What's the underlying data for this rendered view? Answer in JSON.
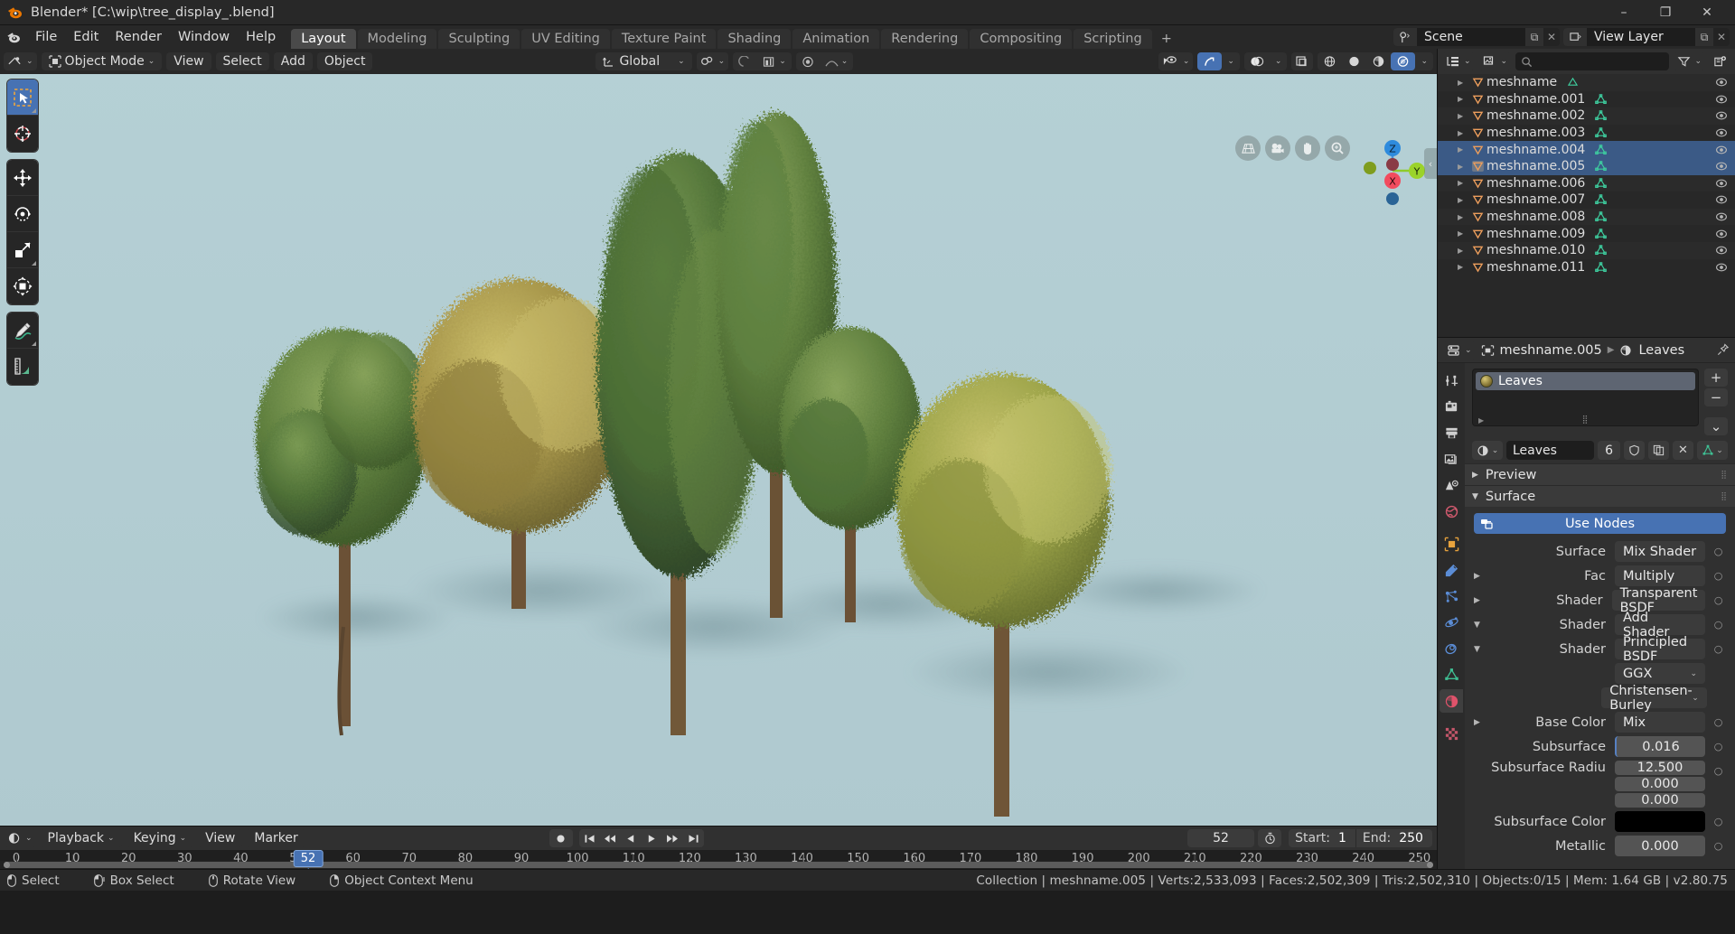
{
  "window": {
    "title": "Blender* [C:\\wip\\tree_display_.blend]",
    "minimize": "–",
    "restore": "❐",
    "close": "✕"
  },
  "topbar": {
    "menus": [
      "File",
      "Edit",
      "Render",
      "Window",
      "Help"
    ],
    "workspaces": [
      "Layout",
      "Modeling",
      "Sculpting",
      "UV Editing",
      "Texture Paint",
      "Shading",
      "Animation",
      "Rendering",
      "Compositing",
      "Scripting"
    ],
    "active_workspace": "Layout",
    "add_workspace": "+",
    "scene_name": "Scene",
    "viewlayer_name": "View Layer",
    "new_btn": "⧉",
    "close_btn": "✕"
  },
  "viewport_header": {
    "mode": "Object Mode",
    "menus": [
      "View",
      "Select",
      "Add",
      "Object"
    ],
    "orientation": "Global",
    "snap_label": "snap-magnet",
    "proportional_label": "proportional-editing"
  },
  "toolbar": {
    "tools": [
      {
        "name": "tweak-select-box",
        "active": true
      },
      {
        "name": "cursor",
        "active": false
      },
      {
        "name": "move",
        "active": false
      },
      {
        "name": "rotate",
        "active": false
      },
      {
        "name": "scale",
        "active": false
      },
      {
        "name": "transform",
        "active": false
      },
      {
        "name": "annotate",
        "active": false
      },
      {
        "name": "measure",
        "active": false
      }
    ]
  },
  "gizmo": {
    "axis_z": "Z",
    "axis_y": "Y",
    "axis_x": "X"
  },
  "nav_buttons": [
    "zoom-grid",
    "camera",
    "hand",
    "magnifier"
  ],
  "outliner": {
    "search_placeholder": "",
    "items": [
      {
        "label": "meshname",
        "selected": false,
        "active": false,
        "partial": true
      },
      {
        "label": "meshname.001",
        "selected": false,
        "active": false
      },
      {
        "label": "meshname.002",
        "selected": false,
        "active": false
      },
      {
        "label": "meshname.003",
        "selected": false,
        "active": false
      },
      {
        "label": "meshname.004",
        "selected": true,
        "active": false
      },
      {
        "label": "meshname.005",
        "selected": true,
        "active": true
      },
      {
        "label": "meshname.006",
        "selected": false,
        "active": false
      },
      {
        "label": "meshname.007",
        "selected": false,
        "active": false
      },
      {
        "label": "meshname.008",
        "selected": false,
        "active": false
      },
      {
        "label": "meshname.009",
        "selected": false,
        "active": false
      },
      {
        "label": "meshname.010",
        "selected": false,
        "active": false
      },
      {
        "label": "meshname.011",
        "selected": false,
        "active": false
      }
    ]
  },
  "properties": {
    "breadcrumb_object": "meshname.005",
    "breadcrumb_material": "Leaves",
    "material_slot": "Leaves",
    "add_slot": "+",
    "remove_slot": "−",
    "slot_menu": "⌄",
    "material_name": "Leaves",
    "material_users": "6",
    "panels": {
      "preview": "Preview",
      "surface": "Surface"
    },
    "use_nodes": "Use Nodes",
    "rows": [
      {
        "label": "Surface",
        "value": "Mix Shader",
        "kind": "dark",
        "tri": ""
      },
      {
        "label": "Fac",
        "value": "Multiply",
        "kind": "dark",
        "tri": "▶"
      },
      {
        "label": "Shader",
        "value": "Transparent BSDF",
        "kind": "dark",
        "tri": "▶"
      },
      {
        "label": "Shader",
        "value": "Add Shader",
        "kind": "dark",
        "tri": "▼"
      },
      {
        "label": "Shader",
        "value": "Principled BSDF",
        "kind": "dark",
        "tri": "▼"
      }
    ],
    "distribution": "GGX",
    "subsurface_method": "Christensen-Burley",
    "base_color_label": "Base Color",
    "base_color_value": "Mix",
    "subsurface_label": "Subsurface",
    "subsurface_value": "0.016",
    "subsurface_radius_label": "Subsurface Radiu",
    "subsurface_radius": [
      "12.500",
      "0.000",
      "0.000"
    ],
    "subsurface_color_label": "Subsurface Color",
    "subsurface_color_value": "#000000",
    "metallic_label": "Metallic",
    "metallic_value": "0.000"
  },
  "timeline": {
    "editor_menu": "timeline-editor",
    "menus": [
      "Playback",
      "Keying",
      "View",
      "Marker"
    ],
    "current_frame": "52",
    "start_label": "Start:",
    "start_value": "1",
    "end_label": "End:",
    "end_value": "250",
    "ticks": [
      0,
      10,
      20,
      30,
      40,
      50,
      60,
      70,
      80,
      90,
      100,
      110,
      120,
      130,
      140,
      150,
      160,
      170,
      180,
      190,
      200,
      210,
      220,
      230,
      240,
      250
    ],
    "range_min": 0,
    "range_max": 256
  },
  "statusbar": {
    "hints": [
      {
        "icon": "mouse-left",
        "label": "Select"
      },
      {
        "icon": "mouse-left-drag",
        "label": "Box Select"
      },
      {
        "icon": "mouse-middle",
        "label": "Rotate View"
      },
      {
        "icon": "mouse-right",
        "label": "Object Context Menu"
      }
    ],
    "stats": "Collection | meshname.005 | Verts:2,533,093 | Faces:2,502,309 | Tris:2,502,310 | Objects:0/15 | Mem: 1.64 GB | v2.80.75"
  },
  "colors": {
    "accent_blue": "#4772b3",
    "selection_blue": "#3b5a86",
    "sky": "#b3cdd2",
    "mesh_orange": "#ed9e5c",
    "mesh_green": "#3ecfa0"
  }
}
